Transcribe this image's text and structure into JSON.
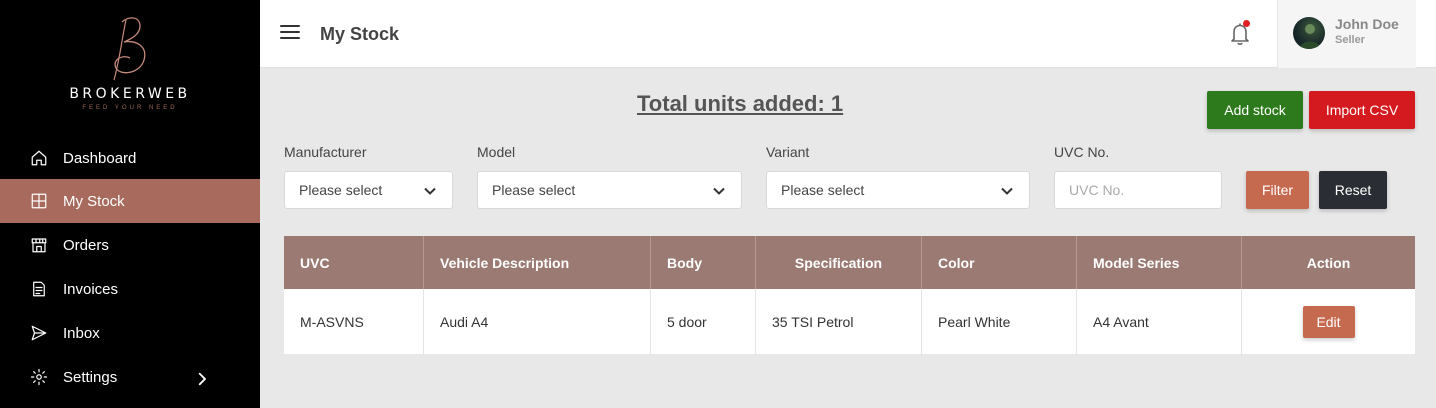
{
  "brand": {
    "name": "BROKERWEB",
    "tagline": "FEED YOUR NEED"
  },
  "sidebar": {
    "items": [
      {
        "label": "Dashboard",
        "icon": "home-icon"
      },
      {
        "label": "My Stock",
        "icon": "grid-icon",
        "active": true
      },
      {
        "label": "Orders",
        "icon": "store-icon"
      },
      {
        "label": "Invoices",
        "icon": "invoice-icon"
      },
      {
        "label": "Inbox",
        "icon": "send-icon"
      },
      {
        "label": "Settings",
        "icon": "gear-icon",
        "has_submenu": true
      }
    ]
  },
  "header": {
    "title": "My Stock",
    "user": {
      "name": "John Doe",
      "role": "Seller"
    },
    "notification_badge_color": "#e02020"
  },
  "main": {
    "total_units": "Total units added: 1",
    "actions": {
      "add_stock": "Add stock",
      "import_csv": "Import CSV"
    },
    "filters": {
      "manufacturer": {
        "label": "Manufacturer",
        "value": "Please select"
      },
      "model": {
        "label": "Model",
        "value": "Please select"
      },
      "variant": {
        "label": "Variant",
        "value": "Please select"
      },
      "uvc": {
        "label": "UVC No.",
        "placeholder": "UVC No.",
        "value": ""
      },
      "filter_button": "Filter",
      "reset_button": "Reset"
    },
    "table": {
      "headers": [
        "UVC",
        "Vehicle Description",
        "Body",
        "Specification",
        "Color",
        "Model Series",
        "Action"
      ],
      "rows": [
        {
          "uvc": "M-ASVNS",
          "description": "Audi A4",
          "body": "5 door",
          "specification": "35 TSI Petrol",
          "color": "Pearl White",
          "model_series": "A4 Avant",
          "action": "Edit"
        }
      ]
    }
  },
  "colors": {
    "sidebar_bg": "#000000",
    "active_nav": "#a86a5c",
    "table_header": "#9a7a73",
    "add_button": "#2d7a1c",
    "import_button": "#d41a1f",
    "filter_button": "#c66a4f",
    "reset_button": "#2a2d34"
  }
}
